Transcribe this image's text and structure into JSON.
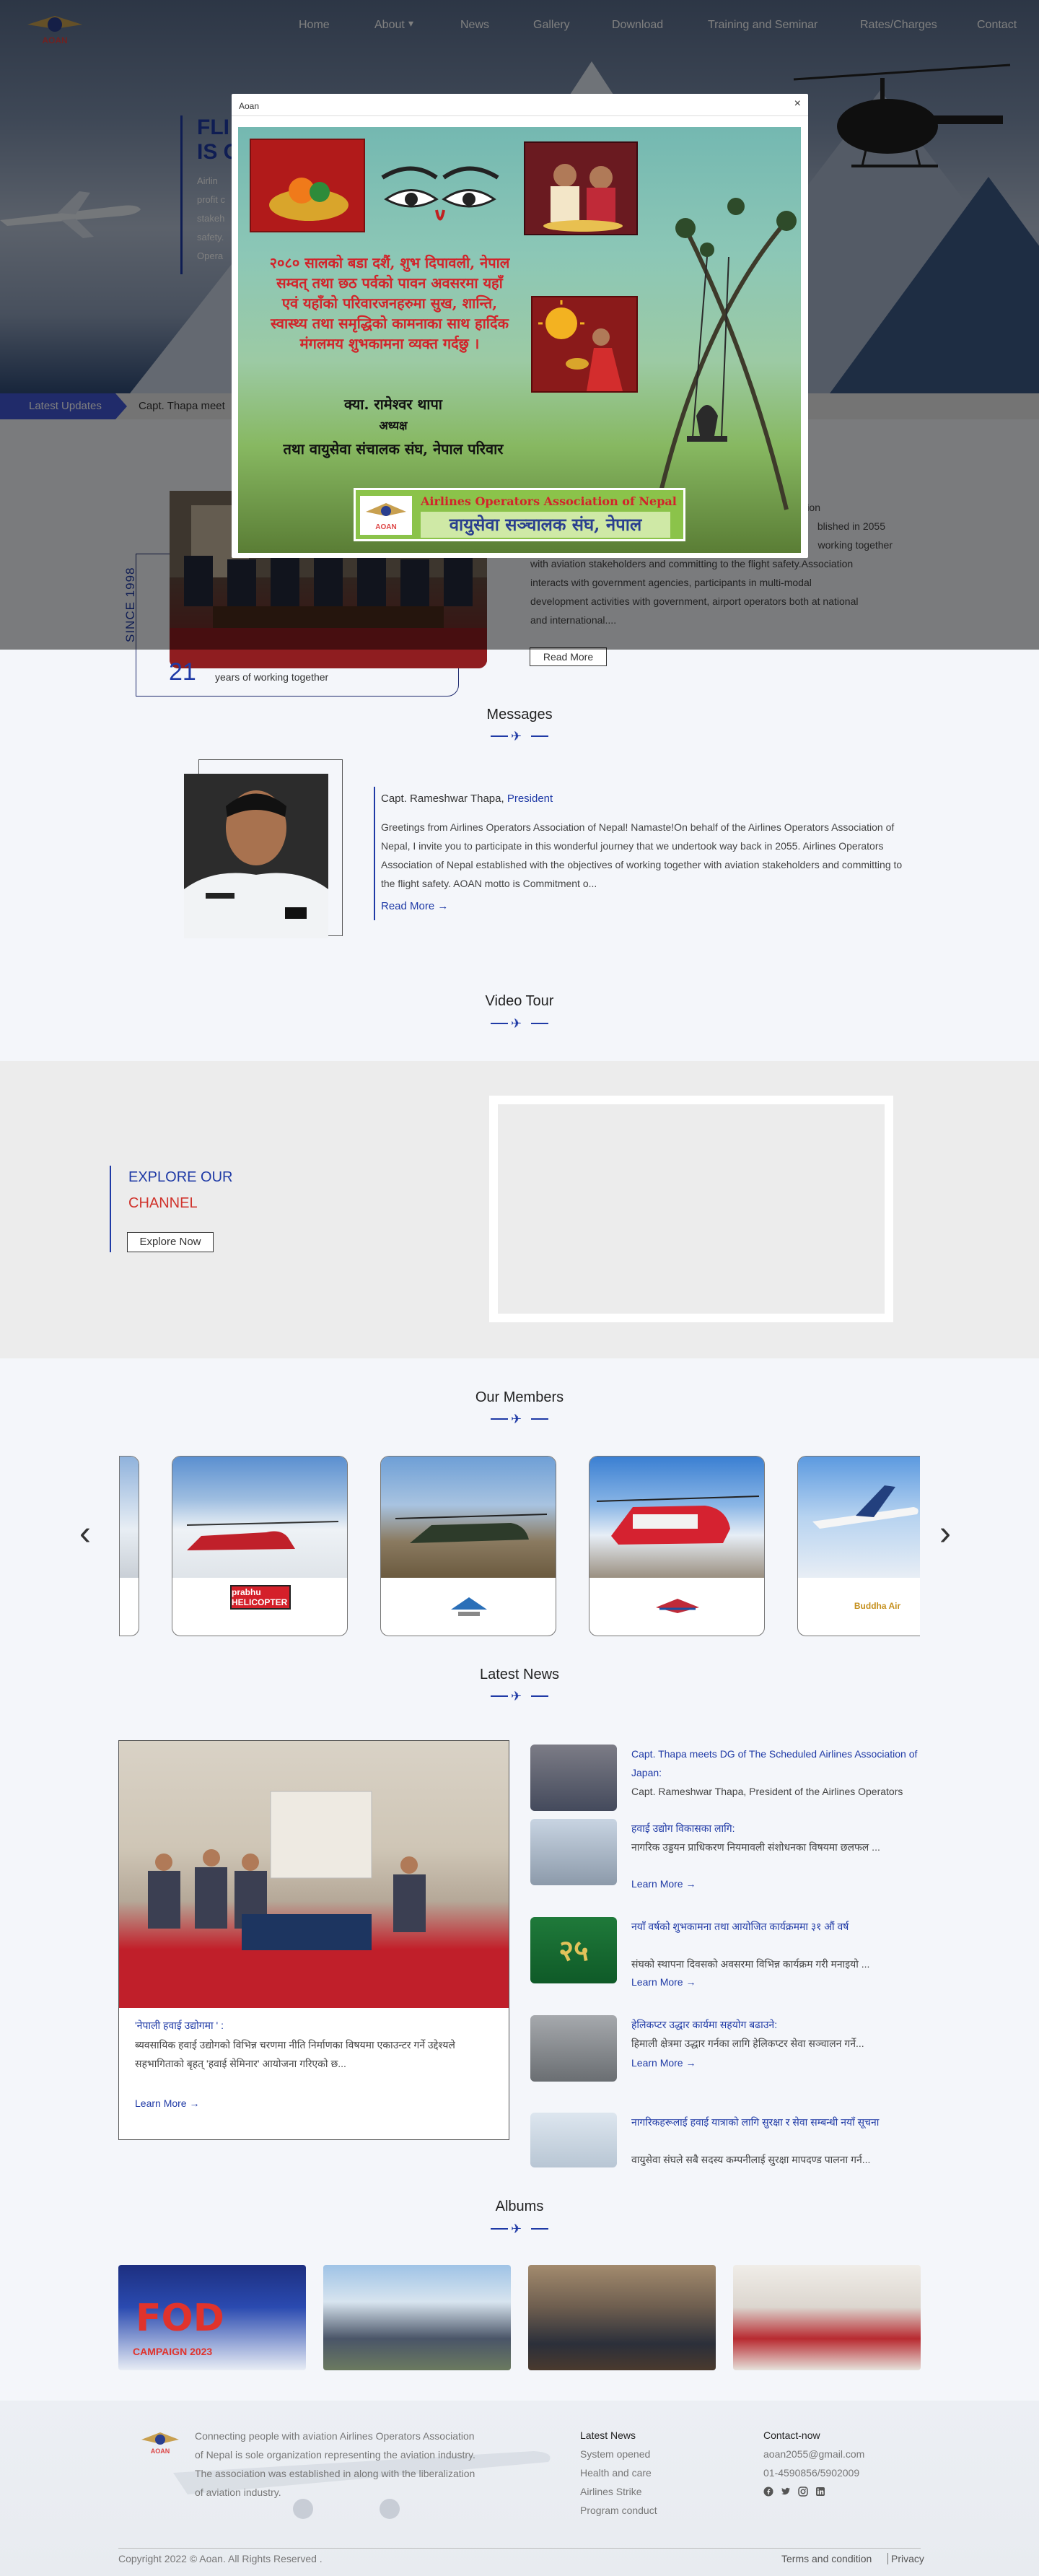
{
  "brand": {
    "logo_text": "AOAN"
  },
  "nav": {
    "items": [
      "Home",
      "About",
      "News",
      "Gallery",
      "Download",
      "Training and Seminar",
      "Rates/Charges",
      "Contact"
    ],
    "about_caret": "▾"
  },
  "hero": {
    "title_line1": "FLI",
    "title_line2": "IS C",
    "desc": [
      "Airlin",
      "profit c",
      "stakeh",
      "safety.",
      "Opera"
    ]
  },
  "updates": {
    "tag": "Latest Updates",
    "text": "Capt. Thapa meet"
  },
  "about": {
    "since": "SINCE 1998",
    "years_num": "21",
    "years_label": "years of working together",
    "text": [
      "ization",
      "blished in 2055",
      "working together",
      "with aviation stakeholders and committing to the flight safety.Association",
      "interacts with government agencies, participants in multi-modal",
      "development activities with government, airport operators both at national",
      "and international...."
    ],
    "read_more": "Read More"
  },
  "messages": {
    "title": "Messages",
    "name": "Capt. Rameshwar Thapa, ",
    "role": "President",
    "body": "Greetings from Airlines Operators Association of Nepal!  Namaste!On behalf of the Airlines Operators Association of Nepal, I invite you to participate in this wonderful journey that we undertook way back in 2055. Airlines Operators Association of Nepal established with the objectives of working together with aviation stakeholders and committing to the flight safety. AOAN motto is Commitment o...",
    "more": "Read More →"
  },
  "video": {
    "title": "Video Tour",
    "explore_line1": "EXPLORE OUR",
    "explore_line2": "CHANNEL",
    "explore_btn": "Explore Now"
  },
  "members": {
    "title": "Our Members",
    "logos": [
      "prabhu HELICOPTER",
      "",
      "",
      "Buddha Air"
    ],
    "prev": "‹",
    "next": "›"
  },
  "news": {
    "title": "Latest News",
    "main": {
      "title": "'नेपाली हवाई उद्योगमा ' :",
      "body": "ब्यवसायिक हवाई उद्योगको विभिन्न चरणमा नीति निर्माणका विषयमा एकाउन्टर गर्ने उद्देश्यले सहभागिताको बृहत् 'हवाई सेमिनार' आयोजना गरिएको छ...",
      "more": "Learn More →"
    },
    "items": [
      {
        "title": "Capt. Thapa meets DG of The Scheduled Airlines Association of Japan:",
        "body": "Capt. Rameshwar Thapa, President of the Airlines Operators",
        "more": ""
      },
      {
        "title": "हवाई उद्योग विकासका लागि:",
        "body": "नागरिक उड्डयन प्राधिकरण नियमावली संशोधनका विषयमा छलफल ...",
        "more": "Learn More →"
      },
      {
        "title": "नयाँ वर्षको शुभकामना तथा आयोजित कार्यक्रममा ३१ औं वर्ष",
        "body": "संघको स्थापना दिवसको अवसरमा विभिन्न कार्यक्रम गरी मनाइयो ...",
        "more": "Learn More →"
      },
      {
        "title": "हेलिकप्टर उद्धार कार्यमा सहयोग बढाउने:",
        "body": "हिमाली क्षेत्रमा उद्धार गर्नका लागि हेलिकप्टर सेवा सञ्चालन गर्ने...",
        "more": "Learn More →"
      },
      {
        "title": "नागरिकहरूलाई हवाई यात्राको लागि सुरक्षा र सेवा सम्बन्धी नयाँ सूचना",
        "body": "वायुसेवा संघले सबै सदस्य कम्पनीलाई सुरक्षा मापदण्ड पालना गर्न...",
        "more": ""
      }
    ]
  },
  "albums": {
    "title": "Albums",
    "first_caption": "FOD",
    "first_sub": "CAMPAIGN 2023"
  },
  "footer": {
    "about": "Connecting people with aviation Airlines Operators Association of Nepal is sole organization representing the aviation industry. The association was established in along with the liberalization of aviation industry.",
    "latest_title": "Latest News",
    "latest_links": [
      "System opened",
      "Health and care",
      "Airlines Strike",
      "Program conduct"
    ],
    "contact_title": "Contact-now",
    "email": "aoan2055@gmail.com",
    "phone": "01-4590856/5902009",
    "copyright": "Copyright 2022 © Aoan. All Rights Reserved .",
    "terms": "Terms and condition",
    "privacy": "Privacy"
  },
  "modal": {
    "title": "Aoan",
    "close": "×",
    "poster_lines": [
      "२०८० सालको बडा दशैं, शुभ दिपावली, नेपाल",
      "सम्वत् तथा छठ पर्वको पावन अवसरमा यहाँ",
      "एवं यहाँको परिवारजनहरुमा सुख, शान्ति,",
      "स्वास्थ्य तथा समृद्धिको कामनाका साथ हार्दिक",
      "मंगलमय शुभकामना व्यक्त गर्दछु ।"
    ],
    "poster_name": "क्या. रामेश्वर थापा",
    "poster_role": "अध्यक्ष",
    "poster_org": "तथा वायुसेवा संचालक संघ, नेपाल परिवार",
    "banner_en": "Airlines Operators Association of Nepal",
    "banner_np": "वायुसेवा सञ्चालक संघ, नेपाल"
  }
}
